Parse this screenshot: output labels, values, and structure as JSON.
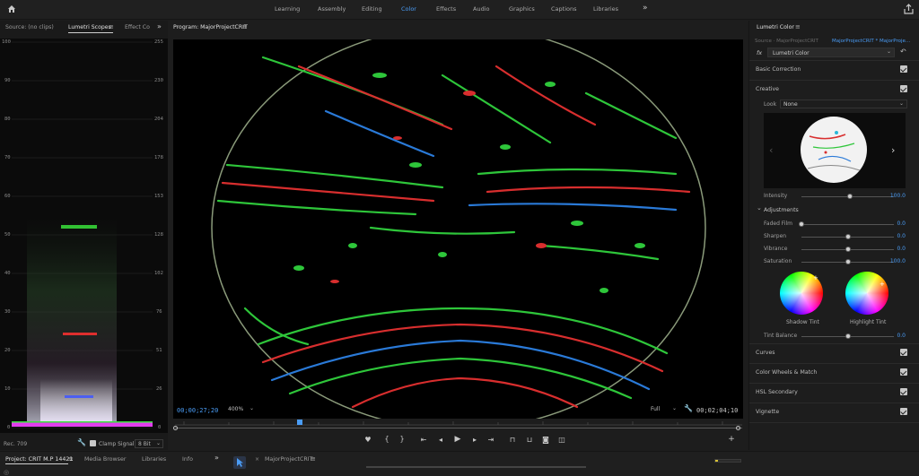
{
  "topbar": {
    "tabs": [
      "Learning",
      "Assembly",
      "Editing",
      "Color",
      "Effects",
      "Audio",
      "Graphics",
      "Captions",
      "Libraries"
    ],
    "active_tab": "Color",
    "more_icon": "double-chevron-right-icon",
    "home_icon": "home-icon",
    "share_icon": "share-icon"
  },
  "scopes_panel": {
    "tabs": [
      "Source: (no clips)",
      "Lumetri Scopes",
      "Effect Co"
    ],
    "menu_icon": "hamburger-menu-icon",
    "left_axis": [
      "100",
      "90",
      "80",
      "70",
      "60",
      "50",
      "40",
      "30",
      "20",
      "10",
      "0"
    ],
    "right_axis": [
      "255",
      "230",
      "204",
      "178",
      "153",
      "128",
      "102",
      "76",
      "51",
      "26",
      "0"
    ],
    "footer_left": "Rec. 709",
    "clamp_label": "Clamp Signal",
    "bit_depth": "8 Bit",
    "colors": {
      "red": "#ff3030",
      "green": "#39e23b",
      "blue": "#4056ff",
      "magenta": "#e23dee"
    }
  },
  "program_monitor": {
    "title": "Program: MajorProjectCRIT",
    "timecode": "00;00;27;20",
    "zoom": "400%",
    "resolution": "Full",
    "duration": "00;02;04;10",
    "accent": "#4a9cf5",
    "controls": [
      "marker-icon",
      "mark-in-icon",
      "mark-out-icon",
      "go-to-in-icon",
      "step-back-icon",
      "play-icon",
      "step-forward-icon",
      "go-to-out-icon",
      "lift-icon",
      "extract-icon",
      "export-frame-icon",
      "comparison-view-icon"
    ],
    "add_icon": "plus-icon"
  },
  "lumetri": {
    "title": "Lumetri Color",
    "source_tab": "Source · MajorProjectCRIT",
    "sequence_tab": "MajorProjectCRIT * MajorProje...",
    "fx_label": "fx",
    "effect_name": "Lumetri Color",
    "sections": {
      "basic": "Basic Correction",
      "creative": "Creative",
      "curves": "Curves",
      "wheels": "Color Wheels & Match",
      "hsl": "HSL Secondary",
      "vignette": "Vignette"
    },
    "look_label": "Look",
    "look_value": "None",
    "intensity_label": "Intensity",
    "intensity_value": "100.0",
    "adjustments_label": "Adjustments",
    "sliders": [
      {
        "label": "Faded Film",
        "value": "0.0",
        "pos": 0.0
      },
      {
        "label": "Sharpen",
        "value": "0.0",
        "pos": 0.5
      },
      {
        "label": "Vibrance",
        "value": "0.0",
        "pos": 0.5
      },
      {
        "label": "Saturation",
        "value": "100.0",
        "pos": 0.5
      }
    ],
    "intensity_pos": 1.0,
    "shadow_tint": "Shadow Tint",
    "highlight_tint": "Highlight Tint",
    "tint_balance_label": "Tint Balance",
    "tint_balance_value": "0.0",
    "tint_balance_pos": 0.5
  },
  "bottom_tabs": {
    "project_tab": "Project: CRIT M.P 14421",
    "media_browser": "Media Browser",
    "libraries": "Libraries",
    "info": "Info",
    "sequence_tab": "MajorProjectCRIT"
  }
}
